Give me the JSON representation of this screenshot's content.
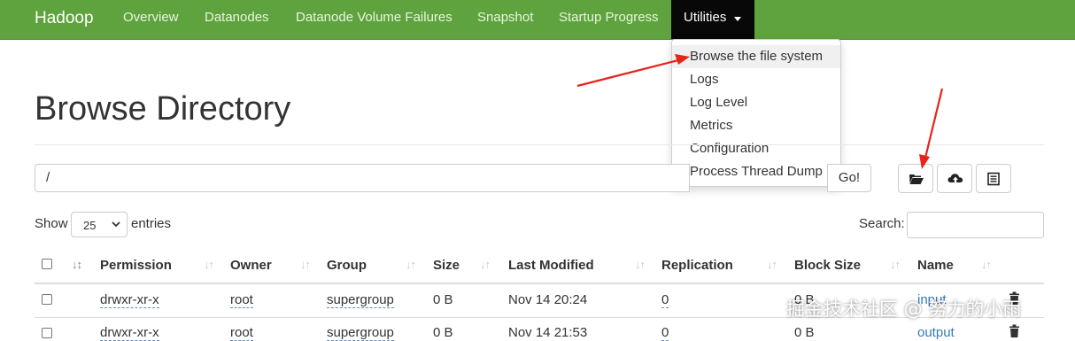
{
  "navbar": {
    "brand": "Hadoop",
    "items": [
      "Overview",
      "Datanodes",
      "Datanode Volume Failures",
      "Snapshot",
      "Startup Progress"
    ],
    "utilities_label": "Utilities",
    "bg_color": "#5fa33e"
  },
  "dropdown": {
    "items": [
      "Browse the file system",
      "Logs",
      "Log Level",
      "Metrics",
      "Configuration",
      "Process Thread Dump"
    ],
    "active_index": 0
  },
  "page": {
    "title": "Browse Directory"
  },
  "path": {
    "value": "/",
    "go_label": "Go!"
  },
  "toolbar": {
    "icons": [
      "folder-open-icon",
      "cloud-upload-icon",
      "list-icon"
    ]
  },
  "entries": {
    "show_label": "Show",
    "selected": "25",
    "entries_label": "entries",
    "search_label": "Search:",
    "search_value": ""
  },
  "table": {
    "columns": [
      "Permission",
      "Owner",
      "Group",
      "Size",
      "Last Modified",
      "Replication",
      "Block Size",
      "Name"
    ],
    "rows": [
      {
        "permission": "drwxr-xr-x",
        "owner": "root",
        "group": "supergroup",
        "size": "0 B",
        "modified": "Nov 14 20:24",
        "replication": "0",
        "block_size": "0 B",
        "name": "input"
      },
      {
        "permission": "drwxr-xr-x",
        "owner": "root",
        "group": "supergroup",
        "size": "0 B",
        "modified": "Nov 14 21:53",
        "replication": "0",
        "block_size": "0 B",
        "name": "output"
      }
    ]
  },
  "annotation_color": "#e8231a",
  "watermark": "掘金技术社区 @ 努力的小雨"
}
